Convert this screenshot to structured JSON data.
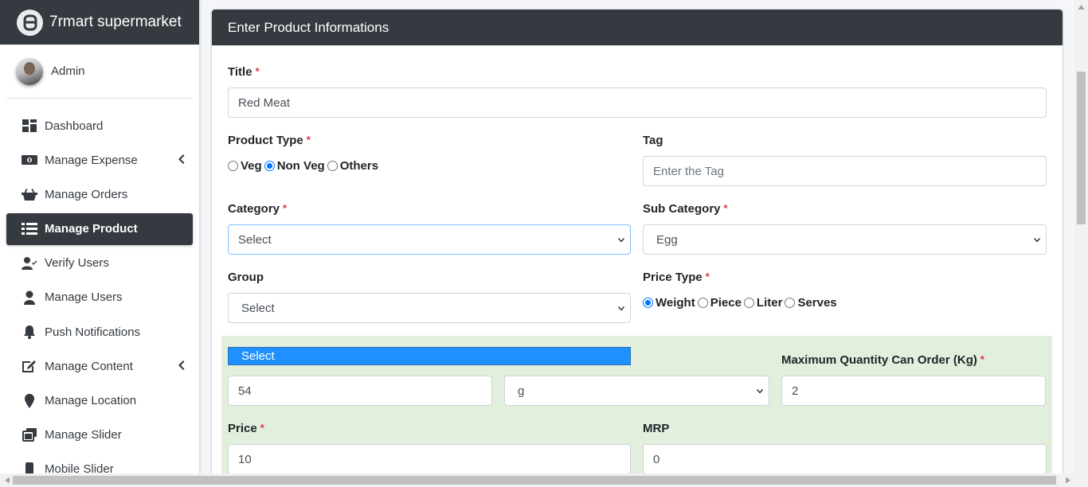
{
  "brand": {
    "name": "7rmart supermarket"
  },
  "user": {
    "name": "Admin"
  },
  "sidebar": {
    "items": [
      {
        "label": "Dashboard",
        "icon": "dashboard-icon"
      },
      {
        "label": "Manage Expense",
        "icon": "money-icon",
        "has_submenu": true
      },
      {
        "label": "Manage Orders",
        "icon": "basket-icon"
      },
      {
        "label": "Manage Product",
        "icon": "list-icon",
        "active": true
      },
      {
        "label": "Verify Users",
        "icon": "user-check-icon"
      },
      {
        "label": "Manage Users",
        "icon": "user-icon"
      },
      {
        "label": "Push Notifications",
        "icon": "bell-icon"
      },
      {
        "label": "Manage Content",
        "icon": "edit-icon",
        "has_submenu": true
      },
      {
        "label": "Manage Location",
        "icon": "map-marker-icon"
      },
      {
        "label": "Manage Slider",
        "icon": "slides-icon"
      },
      {
        "label": "Mobile Slider",
        "icon": "mobile-icon"
      }
    ]
  },
  "form": {
    "header": "Enter Product Informations",
    "title": {
      "label": "Title",
      "value": "Red Meat"
    },
    "product_type": {
      "label": "Product Type",
      "options": [
        "Veg",
        "Non Veg",
        "Others"
      ],
      "selected": "Non Veg"
    },
    "tag": {
      "label": "Tag",
      "placeholder": "Enter the Tag"
    },
    "category": {
      "label": "Category",
      "value": "Select"
    },
    "sub_category": {
      "label": "Sub Category",
      "value": "Egg"
    },
    "group": {
      "label": "Group",
      "value": "Select"
    },
    "price_type": {
      "label": "Price Type",
      "options": [
        "Weight",
        "Piece",
        "Liter",
        "Serves"
      ],
      "selected": "Weight"
    },
    "dropdown_open": {
      "highlighted_option": "Select"
    },
    "weight_value": {
      "value": "54"
    },
    "weight_unit": {
      "value": "g"
    },
    "max_quantity": {
      "label": "Maximum Quantity Can Order (Kg)",
      "value": "2"
    },
    "price": {
      "label": "Price",
      "value": "10"
    },
    "mrp": {
      "label": "MRP",
      "value": "0"
    },
    "required_marker": "*"
  },
  "colors": {
    "header_bg": "#343a40",
    "active_nav": "#343a40",
    "dropdown_highlight": "#1e90ff",
    "section_bg": "#e2efdc",
    "required": "#dc3545"
  }
}
